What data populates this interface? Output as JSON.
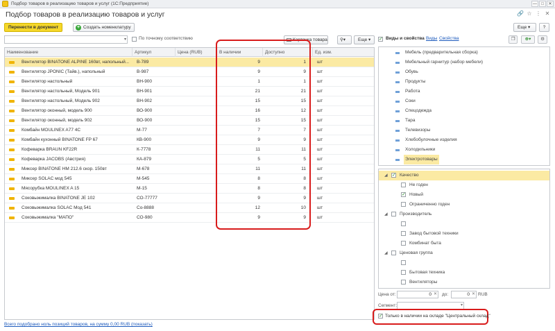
{
  "window": {
    "title": "Подбор товаров в реализацию товаров и услуг (1С:Предприятие)",
    "controls": [
      "—",
      "□",
      "✕"
    ]
  },
  "page": {
    "title": "Подбор товаров в реализацию товаров и услуг",
    "icons": [
      "link-icon",
      "star-icon",
      "more-vertical-icon",
      "close-icon"
    ]
  },
  "toolbar": {
    "transfer_label": "Перенести в документ",
    "create_label": "Создать номенклатуру",
    "more_label": "Еще ▾",
    "help_label": "?"
  },
  "search": {
    "placeholder": "",
    "exact_match_label": "По точному соответствию",
    "card_label": "Карточка товара",
    "filter_label": "▾",
    "more_label": "Еще ▾"
  },
  "table": {
    "columns": [
      "Наименование",
      "Артикул",
      "Цена (RUB)",
      "В наличии",
      "Доступно",
      "Ед. изм."
    ],
    "rows": [
      {
        "name": "Вентилятор BINATONE ALPINE 160вт, напольный...",
        "article": "В-789",
        "price": "",
        "stock": "9",
        "available": "1",
        "unit": "шт"
      },
      {
        "name": "Вентилятор JPONIC (Тайв.), напольный",
        "article": "В-987",
        "price": "",
        "stock": "9",
        "available": "9",
        "unit": "шт"
      },
      {
        "name": "Вентилятор настольный",
        "article": "ВН-900",
        "price": "",
        "stock": "1",
        "available": "1",
        "unit": "шт"
      },
      {
        "name": "Вентилятор настольный, Модель 901",
        "article": "ВН-901",
        "price": "",
        "stock": "21",
        "available": "21",
        "unit": "шт"
      },
      {
        "name": "Вентилятор настольный, Модель 902",
        "article": "ВН-902",
        "price": "",
        "stock": "15",
        "available": "15",
        "unit": "шт"
      },
      {
        "name": "Вентилятор оконный, модель 900",
        "article": "ВО-900",
        "price": "",
        "stock": "16",
        "available": "12",
        "unit": "шт"
      },
      {
        "name": "Вентилятор оконный, модель 902",
        "article": "ВО-900",
        "price": "",
        "stock": "15",
        "available": "15",
        "unit": "шт"
      },
      {
        "name": "Комбайн MOULINEX A77 4C",
        "article": "М-77",
        "price": "",
        "stock": "7",
        "available": "7",
        "unit": "шт"
      },
      {
        "name": "Комбайн кухонный BINATONE FP 67",
        "article": "КВ-900",
        "price": "",
        "stock": "9",
        "available": "9",
        "unit": "шт"
      },
      {
        "name": "Кофеварка BRAUN KF22R",
        "article": "К-7778",
        "price": "",
        "stock": "11",
        "available": "11",
        "unit": "шт"
      },
      {
        "name": "Кофеварка JACOBS (Австрия)",
        "article": "КА-879",
        "price": "",
        "stock": "5",
        "available": "5",
        "unit": "шт"
      },
      {
        "name": "Миксер BINATONE HM 212.6 скор. 150вт",
        "article": "М-678",
        "price": "",
        "stock": "11",
        "available": "11",
        "unit": "шт"
      },
      {
        "name": "Миксер SOLAC мод 545",
        "article": "М-545",
        "price": "",
        "stock": "8",
        "available": "8",
        "unit": "шт"
      },
      {
        "name": "Мясорубка MOULINEX A 15",
        "article": "М-15",
        "price": "",
        "stock": "8",
        "available": "8",
        "unit": "шт"
      },
      {
        "name": "Соковыжималка  BINATONE JE 102",
        "article": "СО-77777",
        "price": "",
        "stock": "9",
        "available": "9",
        "unit": "шт"
      },
      {
        "name": "Соковыжималка  SOLAC  Мод 541",
        "article": "Со-8888",
        "price": "",
        "stock": "12",
        "available": "10",
        "unit": "шт"
      },
      {
        "name": "Соковыжималка \"МАПО\"",
        "article": "СО-980",
        "price": "",
        "stock": "9",
        "available": "9",
        "unit": "шт"
      }
    ]
  },
  "footer": {
    "link_text": "Всего подобрано ноль позиций товаров, на сумму 0,00 RUB (показать)"
  },
  "right_panel": {
    "kinds_label": "Виды и свойства",
    "kinds_link": "Виды",
    "props_link": "Свойства",
    "categories": [
      "Мебель (предварительная сборка)",
      "Мебельный гарнитур (набор мебели)",
      "Обувь",
      "Продукты",
      "Работа",
      "Соки",
      "Спецодежда",
      "Тара",
      "Телевизоры",
      "Хлебобулочные изделия",
      "Холодильники",
      "Электротовары"
    ],
    "properties": [
      {
        "label": "Качество",
        "level": 0,
        "checked": true,
        "sel": true
      },
      {
        "label": "Не годен",
        "level": 1,
        "checked": false
      },
      {
        "label": "Новый",
        "level": 1,
        "checked": true
      },
      {
        "label": "Ограниченно годен",
        "level": 1,
        "checked": false
      },
      {
        "label": "Производитель",
        "level": 0,
        "checked": false
      },
      {
        "label": "",
        "level": 1,
        "checked": false
      },
      {
        "label": "Завод бытовой техники",
        "level": 1,
        "checked": false
      },
      {
        "label": "Комбинат быта",
        "level": 1,
        "checked": false
      },
      {
        "label": "Ценовая группа",
        "level": 0,
        "checked": false
      },
      {
        "label": "",
        "level": 1,
        "checked": false
      },
      {
        "label": "Бытовая техника",
        "level": 1,
        "checked": false
      },
      {
        "label": "Вентиляторы",
        "level": 1,
        "checked": false
      }
    ],
    "price_from_label": "Цена от:",
    "price_from": "0",
    "price_to_label": "до:",
    "price_to": "0",
    "currency": "RUB",
    "segment_label": "Сегмент:",
    "only_stock_label": "Только в наличии на складе \"Центральный склад\""
  },
  "colors": {
    "accent": "#f5d72a",
    "selection": "#fbeaa3",
    "highlight": "#d81b1b",
    "link": "#1e5bbd"
  }
}
